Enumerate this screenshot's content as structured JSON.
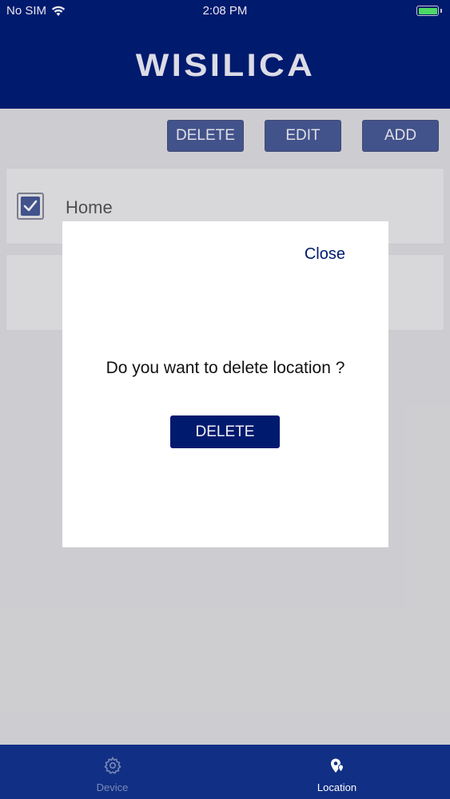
{
  "status_bar": {
    "carrier": "No SIM",
    "time": "2:08 PM"
  },
  "header": {
    "logo": "WISILICA"
  },
  "toolbar": {
    "delete_label": "DELETE",
    "edit_label": "EDIT",
    "add_label": "ADD"
  },
  "locations": [
    {
      "name": "Home",
      "checked": true
    },
    {
      "name": ""
    }
  ],
  "modal": {
    "close_label": "Close",
    "message": "Do you want to delete location ?",
    "delete_label": "DELETE"
  },
  "tabbar": {
    "tabs": [
      {
        "label": "Device",
        "icon": "gear-icon",
        "active": false
      },
      {
        "label": "Location",
        "icon": "location-pin-icon",
        "active": true
      }
    ]
  },
  "colors": {
    "brand": "#001a6e",
    "tabbar": "#112f84",
    "battery": "#4cd964"
  }
}
